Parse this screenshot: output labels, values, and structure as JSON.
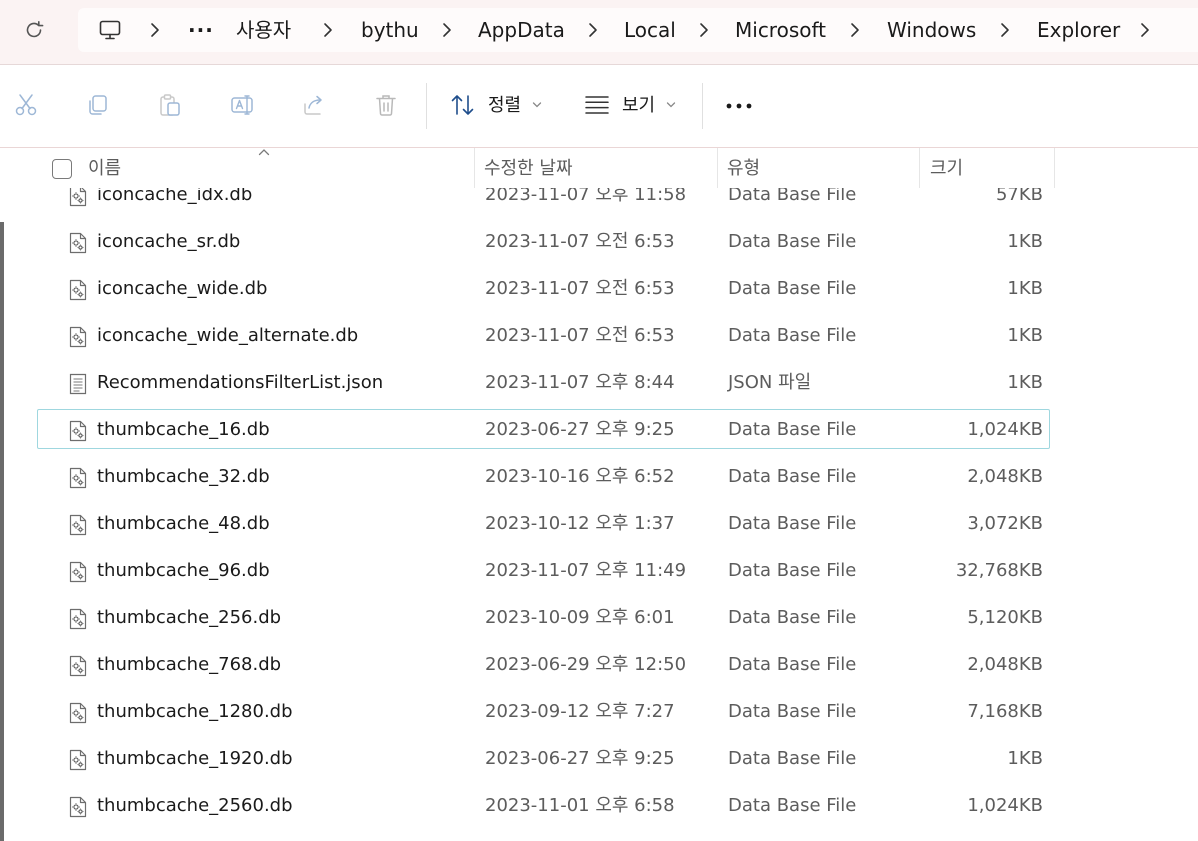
{
  "address_bar": {
    "breadcrumbs": [
      {
        "label": "사용자"
      },
      {
        "label": "bythu"
      },
      {
        "label": "AppData"
      },
      {
        "label": "Local"
      },
      {
        "label": "Microsoft"
      },
      {
        "label": "Windows"
      },
      {
        "label": "Explorer"
      }
    ],
    "overflow_label": "···"
  },
  "command_bar": {
    "sort_label": "정렬",
    "view_label": "보기",
    "more_label": "···"
  },
  "columns": {
    "name": "이름",
    "date": "수정한 날짜",
    "type": "유형",
    "size": "크기"
  },
  "files": [
    {
      "name": "iconcache_idx.db",
      "date": "2023-11-07 오후 11:58",
      "type": "Data Base File",
      "size": "57KB",
      "icon": "db-file-icon"
    },
    {
      "name": "iconcache_sr.db",
      "date": "2023-11-07 오전 6:53",
      "type": "Data Base File",
      "size": "1KB",
      "icon": "db-file-icon"
    },
    {
      "name": "iconcache_wide.db",
      "date": "2023-11-07 오전 6:53",
      "type": "Data Base File",
      "size": "1KB",
      "icon": "db-file-icon"
    },
    {
      "name": "iconcache_wide_alternate.db",
      "date": "2023-11-07 오전 6:53",
      "type": "Data Base File",
      "size": "1KB",
      "icon": "db-file-icon"
    },
    {
      "name": "RecommendationsFilterList.json",
      "date": "2023-11-07 오후 8:44",
      "type": "JSON 파일",
      "size": "1KB",
      "icon": "text-file-icon"
    },
    {
      "name": "thumbcache_16.db",
      "date": "2023-06-27 오후 9:25",
      "type": "Data Base File",
      "size": "1,024KB",
      "icon": "db-file-icon",
      "focused": true
    },
    {
      "name": "thumbcache_32.db",
      "date": "2023-10-16 오후 6:52",
      "type": "Data Base File",
      "size": "2,048KB",
      "icon": "db-file-icon"
    },
    {
      "name": "thumbcache_48.db",
      "date": "2023-10-12 오후 1:37",
      "type": "Data Base File",
      "size": "3,072KB",
      "icon": "db-file-icon"
    },
    {
      "name": "thumbcache_96.db",
      "date": "2023-11-07 오후 11:49",
      "type": "Data Base File",
      "size": "32,768KB",
      "icon": "db-file-icon"
    },
    {
      "name": "thumbcache_256.db",
      "date": "2023-10-09 오후 6:01",
      "type": "Data Base File",
      "size": "5,120KB",
      "icon": "db-file-icon"
    },
    {
      "name": "thumbcache_768.db",
      "date": "2023-06-29 오후 12:50",
      "type": "Data Base File",
      "size": "2,048KB",
      "icon": "db-file-icon"
    },
    {
      "name": "thumbcache_1280.db",
      "date": "2023-09-12 오후 7:27",
      "type": "Data Base File",
      "size": "7,168KB",
      "icon": "db-file-icon"
    },
    {
      "name": "thumbcache_1920.db",
      "date": "2023-06-27 오후 9:25",
      "type": "Data Base File",
      "size": "1KB",
      "icon": "db-file-icon"
    },
    {
      "name": "thumbcache_2560.db",
      "date": "2023-11-01 오후 6:58",
      "type": "Data Base File",
      "size": "1,024KB",
      "icon": "db-file-icon"
    }
  ],
  "colors": {
    "focus_border": "#9fd7df",
    "topbar_bg": "#fbf3f3",
    "icon_gray": "#8c8c8c",
    "icon_blue": "#3a6fb0"
  }
}
